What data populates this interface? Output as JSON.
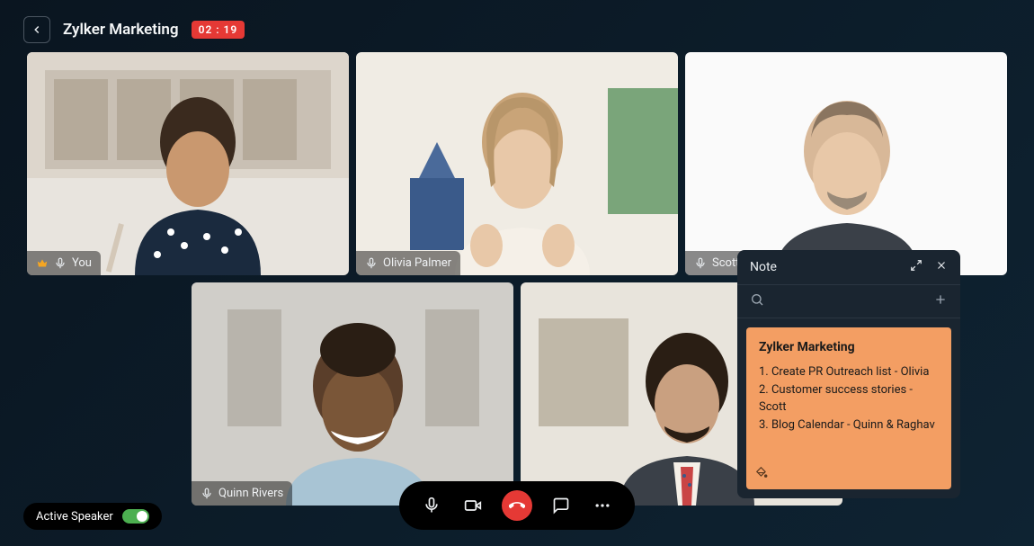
{
  "header": {
    "title": "Zylker Marketing",
    "timer": "02 : 19"
  },
  "participants": [
    {
      "name": "You",
      "is_host": true
    },
    {
      "name": "Olivia Palmer",
      "is_host": false
    },
    {
      "name": "Scott",
      "is_host": false
    },
    {
      "name": "Quinn Rivers",
      "is_host": false
    },
    {
      "name": "",
      "is_host": false
    }
  ],
  "active_speaker": {
    "label": "Active Speaker",
    "on": true
  },
  "note": {
    "panel_title": "Note",
    "sticky_title": "Zylker Marketing",
    "items": [
      "1. Create PR Outreach list - Olivia",
      "2. Customer success stories - Scott",
      "3. Blog Calendar - Quinn & Raghav"
    ]
  }
}
